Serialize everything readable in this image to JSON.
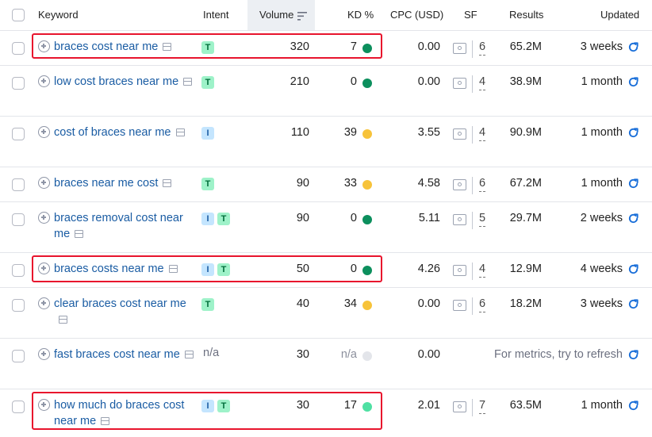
{
  "header": {
    "keyword": "Keyword",
    "intent": "Intent",
    "volume": "Volume",
    "kd": "KD %",
    "cpc": "CPC (USD)",
    "sf": "SF",
    "results": "Results",
    "updated": "Updated"
  },
  "colors": {
    "kd_green": "#0c8f5d",
    "kd_yellow": "#f7c33a",
    "kd_light_green": "#4fe0a3",
    "kd_gray": "#e3e5ea",
    "highlight": "#e8142d"
  },
  "rows": [
    {
      "keyword": "braces cost near me",
      "intent": [
        "T"
      ],
      "volume": "320",
      "kd": "7",
      "kd_color": "green",
      "cpc": "0.00",
      "sf": "6",
      "results": "65.2M",
      "updated": "3 weeks",
      "highlighted": true
    },
    {
      "keyword": "low cost braces near me",
      "intent": [
        "T"
      ],
      "volume": "210",
      "kd": "0",
      "kd_color": "green",
      "cpc": "0.00",
      "sf": "4",
      "results": "38.9M",
      "updated": "1 month",
      "highlighted": false
    },
    {
      "keyword": "cost of braces near me",
      "intent": [
        "I"
      ],
      "volume": "110",
      "kd": "39",
      "kd_color": "yellow",
      "cpc": "3.55",
      "sf": "4",
      "results": "90.9M",
      "updated": "1 month",
      "highlighted": false
    },
    {
      "keyword": "braces near me cost",
      "intent": [
        "T"
      ],
      "volume": "90",
      "kd": "33",
      "kd_color": "yellow",
      "cpc": "4.58",
      "sf": "6",
      "results": "67.2M",
      "updated": "1 month",
      "highlighted": false
    },
    {
      "keyword": "braces removal cost near me",
      "intent": [
        "I",
        "T"
      ],
      "volume": "90",
      "kd": "0",
      "kd_color": "green",
      "cpc": "5.11",
      "sf": "5",
      "results": "29.7M",
      "updated": "2 weeks",
      "highlighted": false
    },
    {
      "keyword": "braces costs near me",
      "intent": [
        "I",
        "T"
      ],
      "volume": "50",
      "kd": "0",
      "kd_color": "green",
      "cpc": "4.26",
      "sf": "4",
      "results": "12.9M",
      "updated": "4 weeks",
      "highlighted": true
    },
    {
      "keyword": "clear braces cost near me",
      "intent": [
        "T"
      ],
      "volume": "40",
      "kd": "34",
      "kd_color": "yellow",
      "cpc": "0.00",
      "sf": "6",
      "results": "18.2M",
      "updated": "3 weeks",
      "highlighted": false
    },
    {
      "keyword": "fast braces cost near me",
      "intent_text": "n/a",
      "volume": "30",
      "kd": "n/a",
      "kd_color": "gray",
      "cpc": "0.00",
      "sf": "",
      "results": "",
      "updated": "For metrics, try to refresh",
      "highlighted": false
    },
    {
      "keyword": "how much do braces cost near me",
      "intent": [
        "I",
        "T"
      ],
      "volume": "30",
      "kd": "17",
      "kd_color": "light_green",
      "cpc": "2.01",
      "sf": "7",
      "results": "63.5M",
      "updated": "1 month",
      "highlighted": true
    }
  ]
}
